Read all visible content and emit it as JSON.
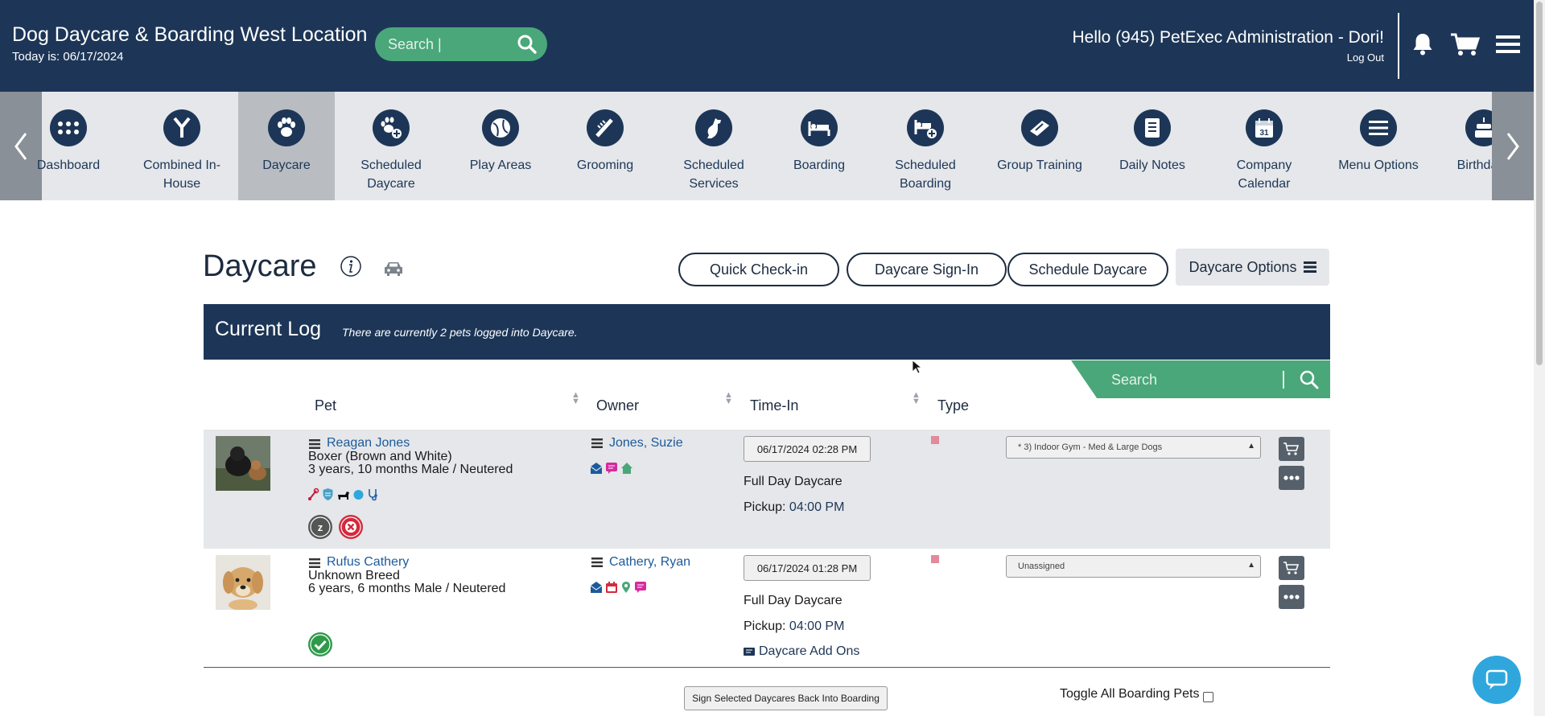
{
  "header": {
    "title": "Dog Daycare & Boarding West Location",
    "date_label": "Today is: 06/17/2024",
    "search_placeholder": "Search |",
    "greeting": "Hello (945) PetExec Administration - Dori!",
    "logout": "Log Out"
  },
  "nav": {
    "items": [
      {
        "label": "Dashboard",
        "icon": "grid-dots-icon"
      },
      {
        "label": "Combined In-House",
        "icon": "merge-arrows-icon"
      },
      {
        "label": "Daycare",
        "icon": "paw-icon",
        "active": true
      },
      {
        "label": "Scheduled Daycare",
        "icon": "paw-plus-icon"
      },
      {
        "label": "Play Areas",
        "icon": "ball-icon"
      },
      {
        "label": "Grooming",
        "icon": "comb-icon"
      },
      {
        "label": "Scheduled Services",
        "icon": "sitting-dog-icon"
      },
      {
        "label": "Boarding",
        "icon": "bed-icon"
      },
      {
        "label": "Scheduled Boarding",
        "icon": "bed-plus-icon"
      },
      {
        "label": "Group Training",
        "icon": "training-icon"
      },
      {
        "label": "Daily Notes",
        "icon": "notes-icon"
      },
      {
        "label": "Company Calendar",
        "icon": "calendar-icon"
      },
      {
        "label": "Menu Options",
        "icon": "menu-lines-icon"
      },
      {
        "label": "Birthdays",
        "icon": "cake-icon"
      }
    ]
  },
  "page": {
    "title": "Daycare",
    "buttons": {
      "quick_checkin": "Quick Check-in",
      "sign_in": "Daycare Sign-In",
      "schedule": "Schedule Daycare",
      "options": "Daycare Options"
    }
  },
  "log": {
    "title": "Current Log",
    "subtitle": "There are currently 2 pets logged into Daycare.",
    "search_placeholder": "Search",
    "columns": {
      "pet": "Pet",
      "owner": "Owner",
      "time_in": "Time-In",
      "type": "Type"
    },
    "rows": [
      {
        "pet_name": "Reagan Jones",
        "breed": "Boxer (Brown and White)",
        "age": "3 years, 10 months Male / Neutered",
        "owner": "Jones, Suzie",
        "time_in": "06/17/2024 02:28 PM",
        "service": "Full Day Daycare",
        "pickup_label": "Pickup:",
        "pickup_time": "04:00 PM",
        "area": "* 3) Indoor Gym - Med & Large Dogs"
      },
      {
        "pet_name": "Rufus Cathery",
        "breed": "Unknown Breed",
        "age": "6 years, 6 months Male / Neutered",
        "owner": "Cathery, Ryan",
        "time_in": "06/17/2024 01:28 PM",
        "service": "Full Day Daycare",
        "pickup_label": "Pickup:",
        "pickup_time": "04:00 PM",
        "area": "Unassigned",
        "addons": "Daycare Add Ons"
      }
    ],
    "footer_button": "Sign Selected Daycares Back Into Boarding",
    "toggle_label": "Toggle All Boarding Pets"
  },
  "colors": {
    "navy": "#1d3657",
    "green": "#4aa77a",
    "nav_bg": "#e5e7ea",
    "chat": "#2fa7dd"
  }
}
